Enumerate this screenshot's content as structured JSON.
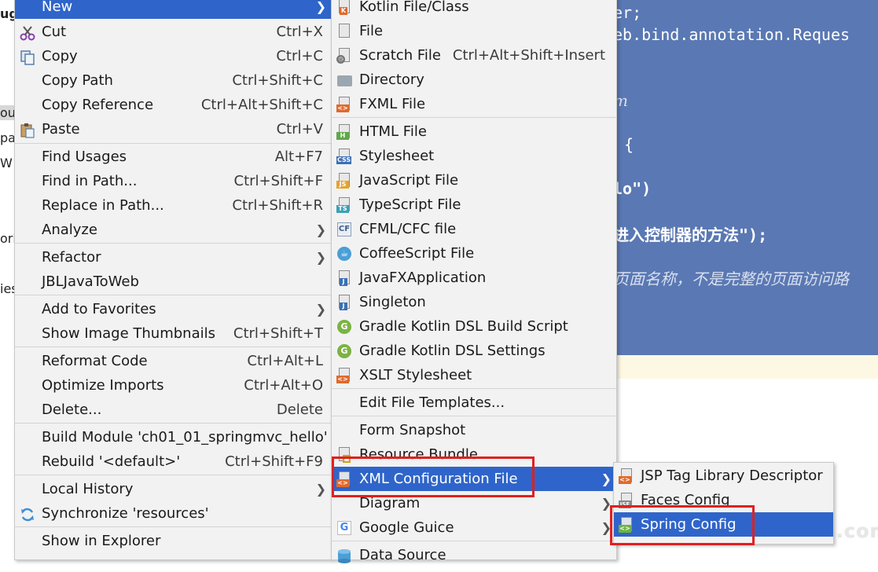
{
  "editor": {
    "lines": [
      {
        "text": "er;",
        "style": "normal"
      },
      {
        "text": "eb.bind.annotation.Reques",
        "style": "normal"
      },
      {
        "text": "m",
        "style": "italic"
      },
      {
        "text": "{",
        "style": "normal"
      },
      {
        "text": "lo\")",
        "style": "bold"
      },
      {
        "text": "进入控制器的方法\");",
        "style": "bold"
      },
      {
        "text": "页面名称，不是完整的页面访问路",
        "style": "italic"
      }
    ]
  },
  "left_strip": [
    "ug",
    "ou",
    "pa",
    "W",
    "ori",
    "ies"
  ],
  "watermark": "yiidian.com",
  "context_menu": {
    "items": [
      {
        "label": "New",
        "shortcut": "",
        "submenu": true,
        "highlight": true,
        "icon": ""
      },
      {
        "label": "Cut",
        "mnemonic": "t",
        "shortcut": "Ctrl+X",
        "icon": "cut-icon"
      },
      {
        "label": "Copy",
        "mnemonic": "C",
        "shortcut": "Ctrl+C",
        "icon": "copy-icon"
      },
      {
        "label": "Copy Path",
        "shortcut": "Ctrl+Shift+C",
        "icon": ""
      },
      {
        "label": "Copy Reference",
        "shortcut": "Ctrl+Alt+Shift+C",
        "icon": ""
      },
      {
        "label": "Paste",
        "shortcut": "Ctrl+V",
        "icon": "paste-icon"
      },
      {
        "label": "Find Usages",
        "shortcut": "Alt+F7",
        "icon": ""
      },
      {
        "label": "Find in Path...",
        "shortcut": "Ctrl+Shift+F",
        "icon": ""
      },
      {
        "label": "Replace in Path...",
        "shortcut": "Ctrl+Shift+R",
        "icon": ""
      },
      {
        "label": "Analyze",
        "shortcut": "",
        "submenu": true,
        "icon": ""
      },
      {
        "label": "Refactor",
        "shortcut": "",
        "submenu": true,
        "icon": ""
      },
      {
        "label": "JBLJavaToWeb",
        "shortcut": "",
        "icon": ""
      },
      {
        "label": "Add to Favorites",
        "shortcut": "",
        "submenu": true,
        "icon": ""
      },
      {
        "label": "Show Image Thumbnails",
        "shortcut": "Ctrl+Shift+T",
        "icon": ""
      },
      {
        "label": "Reformat Code",
        "shortcut": "Ctrl+Alt+L",
        "icon": ""
      },
      {
        "label": "Optimize Imports",
        "shortcut": "Ctrl+Alt+O",
        "icon": ""
      },
      {
        "label": "Delete...",
        "shortcut": "Delete",
        "icon": ""
      },
      {
        "label": "Build Module 'ch01_01_springmvc_hello'",
        "shortcut": "",
        "icon": ""
      },
      {
        "label": "Rebuild '<default>'",
        "shortcut": "Ctrl+Shift+F9",
        "icon": ""
      },
      {
        "label": "Local History",
        "shortcut": "",
        "submenu": true,
        "icon": ""
      },
      {
        "label": "Synchronize 'resources'",
        "shortcut": "",
        "icon": "sync-icon"
      },
      {
        "label": "Show in Explorer",
        "shortcut": "",
        "icon": ""
      }
    ]
  },
  "new_submenu": {
    "items": [
      {
        "label": "Kotlin File/Class",
        "shortcut": "",
        "icon": "kotlin-file-icon"
      },
      {
        "label": "File",
        "shortcut": "",
        "icon": "file-icon"
      },
      {
        "label": "Scratch File",
        "shortcut": "Ctrl+Alt+Shift+Insert",
        "icon": "scratch-file-icon"
      },
      {
        "label": "Directory",
        "shortcut": "",
        "icon": "directory-icon"
      },
      {
        "label": "FXML File",
        "shortcut": "",
        "icon": "fxml-file-icon"
      },
      {
        "label": "HTML File",
        "shortcut": "",
        "icon": "html-file-icon"
      },
      {
        "label": "Stylesheet",
        "shortcut": "",
        "icon": "css-file-icon"
      },
      {
        "label": "JavaScript File",
        "shortcut": "",
        "icon": "javascript-file-icon"
      },
      {
        "label": "TypeScript File",
        "shortcut": "",
        "icon": "typescript-file-icon"
      },
      {
        "label": "CFML/CFC file",
        "shortcut": "",
        "icon": "cfml-file-icon"
      },
      {
        "label": "CoffeeScript File",
        "shortcut": "",
        "icon": "coffeescript-file-icon"
      },
      {
        "label": "JavaFXApplication",
        "shortcut": "",
        "icon": "javafx-icon"
      },
      {
        "label": "Singleton",
        "shortcut": "",
        "icon": "singleton-icon"
      },
      {
        "label": "Gradle Kotlin DSL Build Script",
        "shortcut": "",
        "icon": "gradle-icon"
      },
      {
        "label": "Gradle Kotlin DSL Settings",
        "shortcut": "",
        "icon": "gradle-icon"
      },
      {
        "label": "XSLT Stylesheet",
        "shortcut": "",
        "icon": "xslt-file-icon"
      },
      {
        "label": "Edit File Templates...",
        "shortcut": "",
        "icon": ""
      },
      {
        "label": "Form Snapshot",
        "shortcut": "",
        "icon": ""
      },
      {
        "label": "Resource Bundle",
        "shortcut": "",
        "icon": "resource-bundle-icon"
      },
      {
        "label": "XML Configuration File",
        "shortcut": "",
        "submenu": true,
        "highlight": true,
        "icon": "xml-file-icon"
      },
      {
        "label": "Diagram",
        "shortcut": "",
        "submenu": true,
        "icon": ""
      },
      {
        "label": "Google Guice",
        "shortcut": "",
        "submenu": true,
        "icon": "google-icon"
      },
      {
        "label": "Data Source",
        "shortcut": "",
        "icon": "data-source-icon"
      }
    ]
  },
  "xml_submenu": {
    "items": [
      {
        "label": "JSP Tag Library Descriptor",
        "icon": "jsp-tld-icon"
      },
      {
        "label": "Faces Config",
        "icon": "faces-config-icon"
      },
      {
        "label": "Spring Config",
        "highlight": true,
        "icon": "spring-config-icon"
      }
    ]
  },
  "colors": {
    "menu_bg": "#f2f2f2",
    "highlight": "#2f65ca",
    "editor_bg": "#5a78b3",
    "annotation_red": "#e02020"
  }
}
